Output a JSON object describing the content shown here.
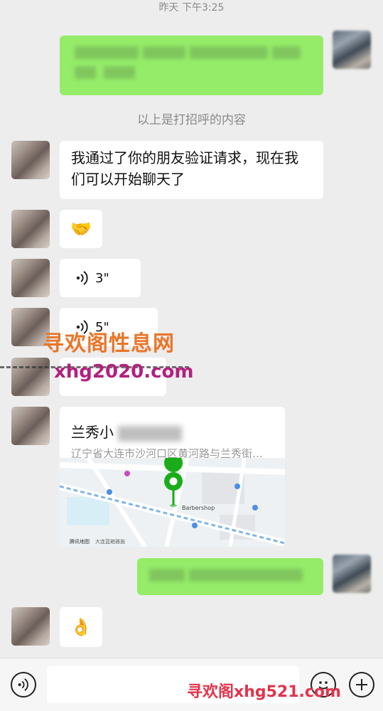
{
  "chat": {
    "timestamp": "昨天 下午3:25",
    "system_note": "以上是打招呼的内容",
    "messages": {
      "friend_accepted": "我通过了你的朋友验证请求，现在我们可以开始聊天了",
      "emoji_handshake": "🤝",
      "voice1_duration": "3\"",
      "voice2_duration": "5\"",
      "location_title": "兰秀小",
      "location_address": "辽宁省大连市沙河口区黄河路与兰秀街…",
      "emoji_ok": "👌"
    },
    "map": {
      "attribution": "腾讯地图",
      "poi_shop": "Barbershop",
      "poi_hotel": "大连蓝箱雅施"
    }
  },
  "watermark": {
    "line1": "寻欢阁性息网",
    "line2": "xhg2020.com",
    "bottom": "寻欢阁xhg521.com"
  },
  "colors": {
    "background": "#ededed",
    "outgoing_bubble": "#95ec69",
    "incoming_bubble": "#ffffff",
    "map_pin": "#1aad19"
  },
  "icons": {
    "voice_toggle": "voice-icon",
    "emoji": "emoji-icon",
    "more": "plus-icon"
  }
}
